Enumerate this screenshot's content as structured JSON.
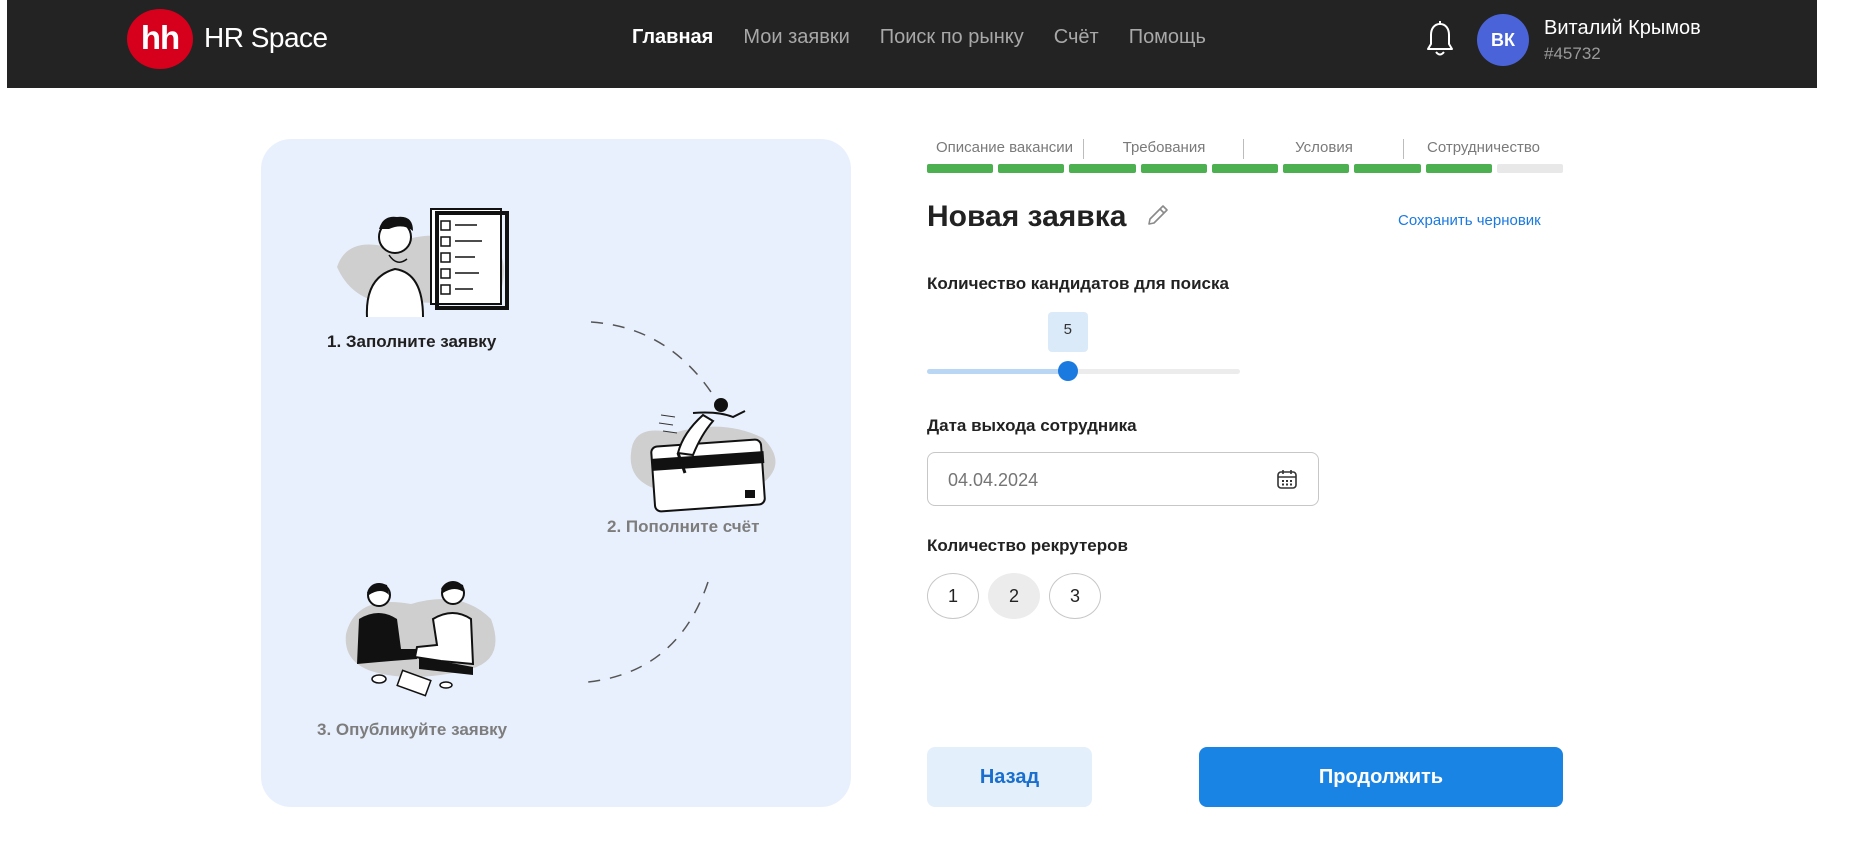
{
  "header": {
    "logo_text": "hh",
    "brand": "HR Space",
    "nav": [
      {
        "label": "Главная",
        "active": true
      },
      {
        "label": "Мои заявки",
        "active": false
      },
      {
        "label": "Поиск по рынку",
        "active": false
      },
      {
        "label": "Счёт",
        "active": false
      },
      {
        "label": "Помощь",
        "active": false
      }
    ],
    "notification_icon": "bell-icon",
    "user": {
      "initials": "ВК",
      "name": "Виталий Крымов",
      "id": "#45732"
    }
  },
  "steps_panel": {
    "steps": [
      {
        "label": "1. Заполните заявку",
        "illustration": "person-with-checklist",
        "done": true
      },
      {
        "label": "2. Пополните счёт",
        "illustration": "person-on-credit-card",
        "done": false
      },
      {
        "label": "3. Опубликуйте заявку",
        "illustration": "handshake",
        "done": false
      }
    ]
  },
  "progress": {
    "sections": [
      "Описание вакансии",
      "Требования",
      "Условия",
      "Сотрудничество"
    ],
    "segments_total": 9,
    "segments_filled": 8,
    "filled_color": "#4caf50",
    "empty_color": "#e8e8e8"
  },
  "form": {
    "title": "Новая заявка",
    "save_draft": "Сохранить черновик",
    "candidates": {
      "label": "Количество кандидатов для поиска",
      "value": "5",
      "fraction": 0.45
    },
    "start_date": {
      "label": "Дата выхода сотрудника",
      "placeholder": "04.04.2024"
    },
    "recruiters": {
      "label": "Количество рекрутеров",
      "options": [
        "1",
        "2",
        "3"
      ],
      "selected": "2"
    },
    "back_label": "Назад",
    "continue_label": "Продолжить"
  }
}
